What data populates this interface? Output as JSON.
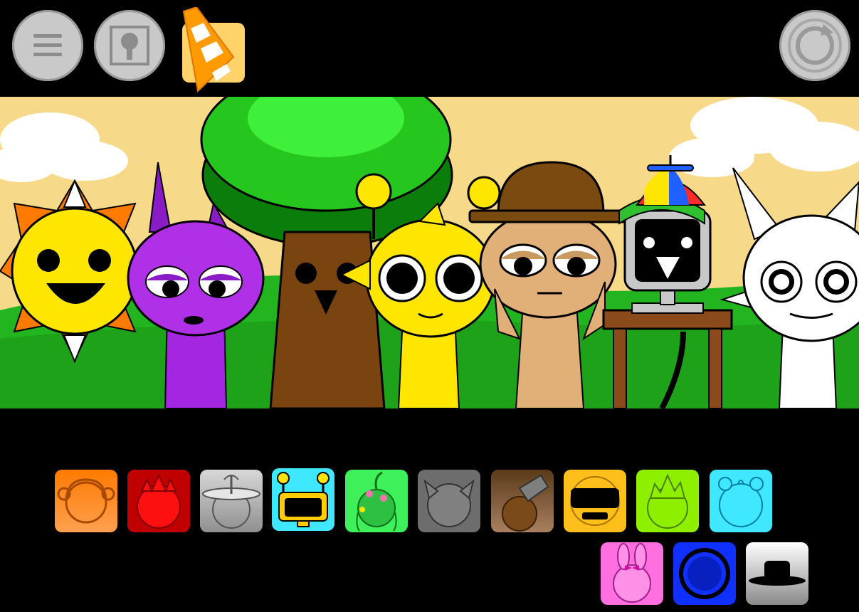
{
  "toolbar": {
    "menu_icon": "hamburger-menu-icon",
    "gallery_icon": "avatar-frame-icon",
    "logo_icon": "traffic-cone-logo",
    "reset_icon": "reset-cycle-icon"
  },
  "scene": {
    "sky_color": "#f7d98a",
    "grass_color": "#22b51f",
    "characters": [
      "sun-head",
      "purple-horned",
      "tree",
      "yellow-antenna",
      "brown-hat",
      "computer-monitor",
      "white-spiky"
    ]
  },
  "palette": {
    "row1": [
      {
        "name": "orange-headphones",
        "color": "#ff7a00"
      },
      {
        "name": "red-spiky",
        "color": "#e60000"
      },
      {
        "name": "gray-satellite",
        "color": "#b8b8b8"
      },
      {
        "name": "cyan-tv-antenna",
        "color": "#40e8ff"
      },
      {
        "name": "green-flowers",
        "color": "#3ef05a"
      },
      {
        "name": "gray-cat",
        "color": "#7d7d7d"
      },
      {
        "name": "brown-tophat",
        "color": "#7a4a1a"
      },
      {
        "name": "yellow-visor",
        "color": "#ffbf1a"
      },
      {
        "name": "lime-flame",
        "color": "#8ef000"
      },
      {
        "name": "cyan-bear",
        "color": "#40e8ff"
      }
    ],
    "row2": [
      {
        "name": "pink-bunny",
        "color": "#ff6fe0"
      },
      {
        "name": "blue-ring",
        "color": "#1030ff"
      },
      {
        "name": "black-hat",
        "color": "#ffffff"
      }
    ]
  }
}
